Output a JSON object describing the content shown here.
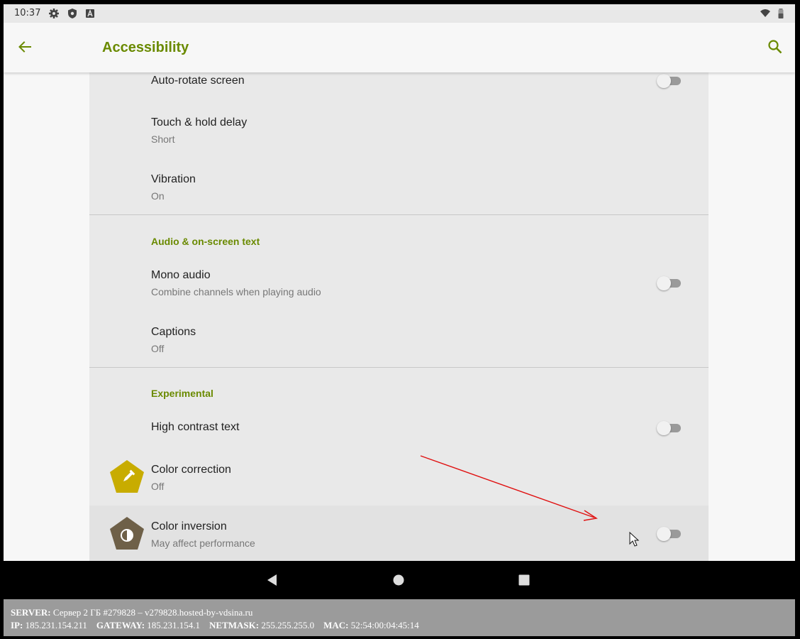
{
  "status_bar": {
    "time": "10:37",
    "icons": [
      "settings-icon",
      "shield-icon",
      "notification-a-icon",
      "wifi-icon",
      "battery-icon"
    ]
  },
  "app_bar": {
    "title": "Accessibility",
    "back_icon": "arrow-left-icon",
    "search_icon": "search-icon"
  },
  "settings": {
    "auto_rotate": {
      "title": "Auto-rotate screen",
      "enabled": false
    },
    "touch_hold": {
      "title": "Touch & hold delay",
      "summary": "Short"
    },
    "vibration": {
      "title": "Vibration",
      "summary": "On"
    },
    "audio_header": "Audio & on-screen text",
    "mono_audio": {
      "title": "Mono audio",
      "summary": "Combine channels when playing audio",
      "enabled": false
    },
    "captions": {
      "title": "Captions",
      "summary": "Off"
    },
    "experimental_header": "Experimental",
    "high_contrast": {
      "title": "High contrast text",
      "enabled": false
    },
    "color_correction": {
      "title": "Color correction",
      "summary": "Off",
      "icon": "eyedropper-icon"
    },
    "color_inversion": {
      "title": "Color inversion",
      "summary": "May affect performance",
      "icon": "contrast-icon",
      "enabled": false
    }
  },
  "nav_bar": {
    "back": "nav-back-icon",
    "home": "nav-home-icon",
    "recents": "nav-recents-icon"
  },
  "server_info": {
    "server_label": "SERVER:",
    "server_value": "Сервер 2 ГБ #279828 – v279828.hosted-by-vdsina.ru",
    "ip_label": "IP:",
    "ip_value": "185.231.154.211",
    "gateway_label": "GATEWAY:",
    "gateway_value": "185.231.154.1",
    "netmask_label": "NETMASK:",
    "netmask_value": "255.255.255.0",
    "mac_label": "MAC:",
    "mac_value": "52:54:00:04:45:14"
  },
  "colors": {
    "accent": "#6a8a00",
    "color_correction_badge": "#c8ac00",
    "color_inversion_badge": "#6e6048",
    "arrow": "#e01010"
  }
}
